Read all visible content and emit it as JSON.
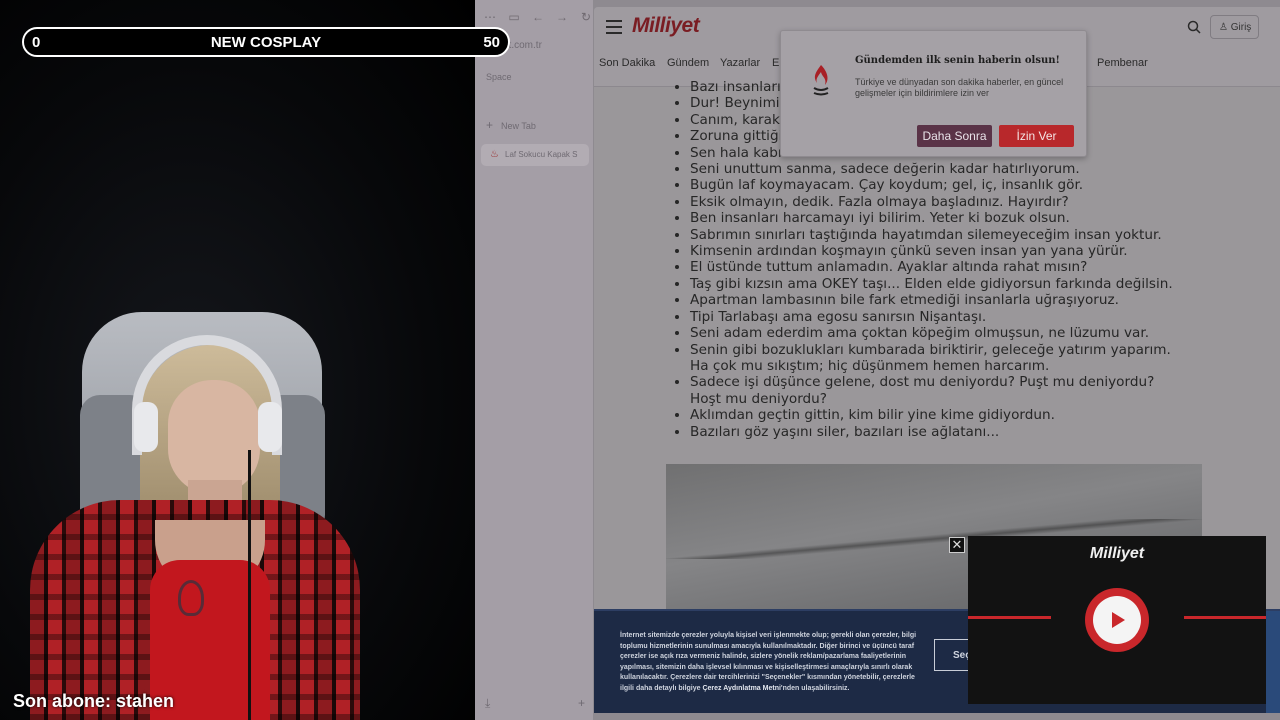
{
  "overlay": {
    "progress_left": "0",
    "progress_title": "NEW COSPLAY",
    "progress_right": "50",
    "last_sub": "Son abone: stahen"
  },
  "browser_sidebar": {
    "url": "et.com.tr",
    "space_label": "Space",
    "new_tab_label": "New Tab",
    "tab_title": "Laf Sokucu Kapak S"
  },
  "site": {
    "logo": "Milliyet",
    "login_label": "Giriş",
    "nav": [
      "Son Dakika",
      "Gündem",
      "Yazarlar",
      "E",
      "Pembenar"
    ]
  },
  "article": {
    "lines": [
      "Bazı insanları",
      "Dur! Beynimi",
      "Canım, karak",
      "Zoruna gittiği",
      "Sen hala kabı",
      "Seni unuttum sanma, sadece değerin kadar hatırlıyorum.",
      "Bugün laf koymayacam. Çay koydum; gel, iç, insanlık gör.",
      "Eksik olmayın, dedik. Fazla olmaya başladınız. Hayırdır?",
      "Ben insanları harcamayı iyi bilirim. Yeter ki bozuk olsun.",
      "Sabrımın sınırları taştığında hayatımdan silemeyeceğim insan yoktur.",
      "Kimsenin ardından koşmayın çünkü seven insan yan yana yürür.",
      "El üstünde tuttum anlamadın. Ayaklar altında rahat mısın?",
      "Taş gibi kızsın ama OKEY taşı... Elden elde gidiyorsun farkında değilsin.",
      "Apartman lambasının bile fark etmediği insanlarla uğraşıyoruz.",
      "Tipi Tarlabaşı ama egosu sanırsın Nişantaşı.",
      "Seni adam ederdim ama çoktan köpeğim olmuşsun, ne lüzumu var.",
      "Senin gibi bozuklukları kumbarada biriktirir, geleceğe yatırım yaparım.",
      "Ha çok mu sıkıştım; hiç düşünmem hemen harcarım.",
      "Sadece işi düşünce gelene, dost mu deniyordu? Puşt mu deniyordu?",
      "Hoşt mu deniyordu?",
      "Aklımdan geçtin gittin, kim bilir yine kime gidiyordun.",
      "Bazıları göz yaşını siler, bazıları ise ağlatanı..."
    ]
  },
  "notification": {
    "title": "Gündemden ilk senin haberin olsun!",
    "body": "Türkiye ve dünyadan son dakika haberler, en güncel gelişmeler için bildirimlere izin ver",
    "later_label": "Daha Sonra",
    "allow_label": "İzin Ver"
  },
  "cookie": {
    "text": "İnternet sitemizde çerezler yoluyla kişisel veri işlenmekte olup; gerekli olan çerezler, bilgi toplumu hizmetlerinin sunulması amacıyla kullanılmaktadır. Diğer birinci ve üçüncü taraf çerezler ise açık rıza vermeniz halinde, sizlere yönelik reklam/pazarlama faaliyetlerinin yapılması, sitemizin daha işlevsel kılınması ve kişiselleştirmesi amaçlarıyla sınırlı olarak kullanılacaktır. Çerezlere dair tercihlerinizi \"Seçenekler\" kısmından yönetebilir, çerezlerle ilgili daha detaylı bilgiye ",
    "link": "Çerez Aydınlatma Metni",
    "text_end": "'nden ulaşabilirsiniz.",
    "options_label": "Seç"
  },
  "video": {
    "logo": "Milliyet",
    "close_label": "✕"
  },
  "colors": {
    "brand_red": "#c9272b",
    "later_button": "#5a3347",
    "cookie_bg": "#1d2a45"
  }
}
